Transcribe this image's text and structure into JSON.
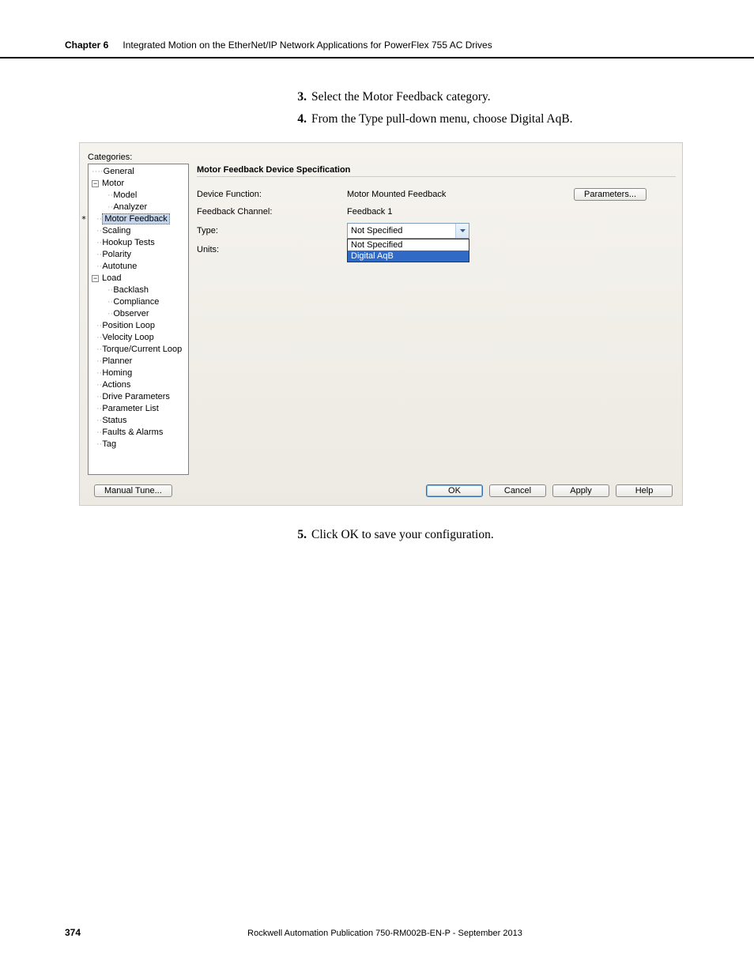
{
  "header": {
    "chapter_label": "Chapter 6",
    "chapter_title": "Integrated Motion on the EtherNet/IP Network Applications for PowerFlex 755 AC Drives"
  },
  "steps": {
    "s3_num": "3.",
    "s3_text": "Select the Motor Feedback category.",
    "s4_num": "4.",
    "s4_text": "From the Type pull-down menu, choose Digital AqB.",
    "s5_num": "5.",
    "s5_text": "Click OK to save your configuration."
  },
  "dialog": {
    "categories_label": "Categories:",
    "star": "*",
    "tree": {
      "general": "General",
      "motor": "Motor",
      "model": "Model",
      "analyzer": "Analyzer",
      "motor_feedback": "Motor Feedback",
      "scaling": "Scaling",
      "hookup_tests": "Hookup Tests",
      "polarity": "Polarity",
      "autotune": "Autotune",
      "load": "Load",
      "backlash": "Backlash",
      "compliance": "Compliance",
      "observer": "Observer",
      "position_loop": "Position Loop",
      "velocity_loop": "Velocity Loop",
      "torque_loop": "Torque/Current Loop",
      "planner": "Planner",
      "homing": "Homing",
      "actions": "Actions",
      "drive_parameters": "Drive Parameters",
      "parameter_list": "Parameter List",
      "status": "Status",
      "faults": "Faults & Alarms",
      "tag": "Tag"
    },
    "group_title": "Motor Feedback Device Specification",
    "labels": {
      "device_function": "Device Function:",
      "feedback_channel": "Feedback Channel:",
      "type": "Type:",
      "units": "Units:"
    },
    "values": {
      "device_function": "Motor Mounted Feedback",
      "feedback_channel": "Feedback 1",
      "type_selected": "Not Specified"
    },
    "type_options": {
      "opt0": "Not Specified",
      "opt1": "Digital AqB"
    },
    "buttons": {
      "parameters": "Parameters...",
      "manual_tune": "Manual Tune...",
      "ok": "OK",
      "cancel": "Cancel",
      "apply": "Apply",
      "help": "Help"
    }
  },
  "footer": {
    "page": "374",
    "publication": "Rockwell Automation Publication 750-RM002B-EN-P - September 2013"
  }
}
